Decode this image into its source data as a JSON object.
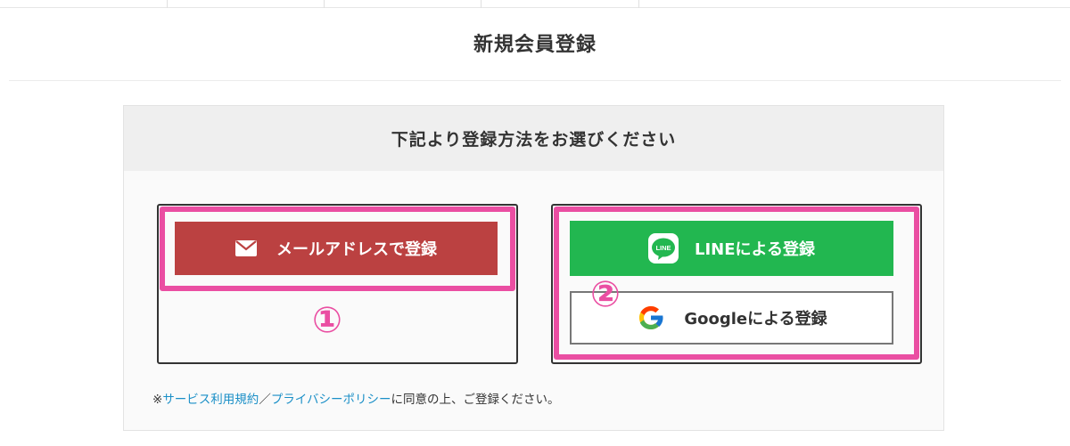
{
  "page": {
    "title": "新規会員登録"
  },
  "panel": {
    "heading": "下記より登録方法をお選びください"
  },
  "options": {
    "email": {
      "label": "メールアドレスで登録",
      "icon": "mail-icon",
      "color": "#bb4141"
    },
    "line": {
      "label": "LINEによる登録",
      "icon": "line-icon",
      "icon_text": "LINE",
      "color": "#22b750"
    },
    "google": {
      "label": "Googleによる登録",
      "icon": "google-icon"
    }
  },
  "annotations": {
    "first": "①",
    "second": "②",
    "highlight_color": "#ea4ea2"
  },
  "terms": {
    "prefix": "※",
    "link1": "サービス利用規約",
    "slash": "／",
    "link2": "プライバシーポリシー",
    "suffix": "に同意の上、ご登録ください。"
  }
}
